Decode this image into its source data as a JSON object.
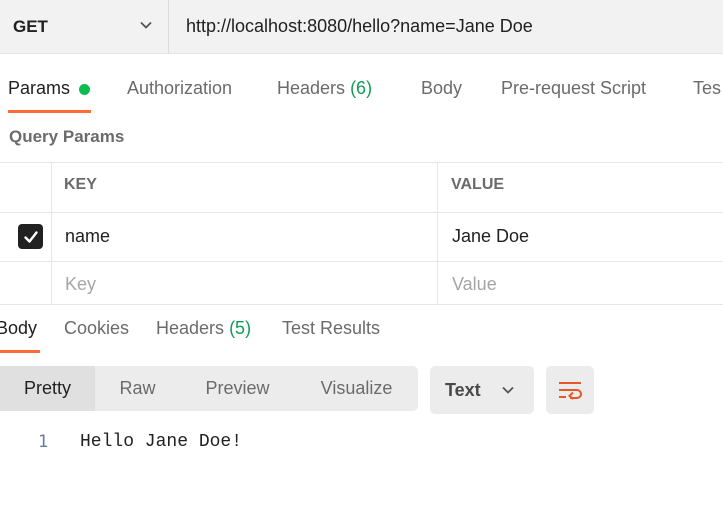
{
  "request": {
    "method": "GET",
    "url": "http://localhost:8080/hello?name=Jane Doe"
  },
  "request_tabs": [
    {
      "label": "Params",
      "active": true,
      "indicator_color": "#0cbb52"
    },
    {
      "label": "Authorization"
    },
    {
      "label": "Headers",
      "count": "(6)"
    },
    {
      "label": "Body"
    },
    {
      "label": "Pre-request Script"
    },
    {
      "label": "Tes"
    }
  ],
  "query_params": {
    "title": "Query Params",
    "columns": {
      "key": "KEY",
      "value": "VALUE"
    },
    "rows": [
      {
        "checked": true,
        "key": "name",
        "value": "Jane Doe"
      }
    ],
    "placeholder": {
      "key": "Key",
      "value": "Value"
    }
  },
  "response_tabs": [
    {
      "label": "Body",
      "active": true
    },
    {
      "label": "Cookies"
    },
    {
      "label": "Headers",
      "count": "(5)"
    },
    {
      "label": "Test Results"
    }
  ],
  "view_modes": [
    "Pretty",
    "Raw",
    "Preview",
    "Visualize"
  ],
  "active_view_mode": "Pretty",
  "format": "Text",
  "icons": {
    "method_dropdown": "chevron-down-icon",
    "format_dropdown": "chevron-down-icon",
    "wrap": "wrap-lines-icon",
    "check": "check-icon"
  },
  "response_body": {
    "lines": [
      {
        "number": "1",
        "text": "Hello Jane Doe!"
      }
    ]
  },
  "colors": {
    "accent": "#ff6c37",
    "success": "#0f9d58",
    "wrap_icon": "#e8562a"
  }
}
